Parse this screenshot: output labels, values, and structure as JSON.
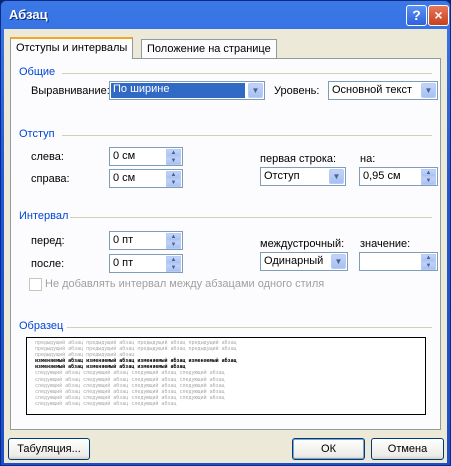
{
  "window": {
    "title": "Абзац",
    "help_glyph": "?",
    "close_glyph": "×"
  },
  "tabs": [
    {
      "label": "Отступы и интервалы",
      "active": true
    },
    {
      "label": "Положение на странице",
      "active": false
    }
  ],
  "general": {
    "heading": "Общие",
    "alignment_label": "Выравнивание:",
    "alignment_value": "По ширине",
    "level_label": "Уровень:",
    "level_value": "Основной текст"
  },
  "indent": {
    "heading": "Отступ",
    "left_label": "слева:",
    "left_value": "0 см",
    "right_label": "справа:",
    "right_value": "0 см",
    "first_line_label": "первая строка:",
    "first_line_value": "Отступ",
    "by_label": "на:",
    "by_value": "0,95 см"
  },
  "spacing": {
    "heading": "Интервал",
    "before_label": "перед:",
    "before_value": "0 пт",
    "after_label": "после:",
    "after_value": "0 пт",
    "line_label": "междустрочный:",
    "line_value": "Одинарный",
    "at_label": "значение:",
    "at_value": "",
    "dont_add_label": "Не добавлять интервал между абзацами одного стиля",
    "dont_add_checked": false
  },
  "preview": {
    "heading": "Образец",
    "prev_lines": [
      "предыдущий абзац предыдущий абзац предыдущий абзац предыдущий абзац",
      "предыдущий абзац предыдущий абзац предыдущий абзац предыдущий абзац",
      "предыдущий абзац предыдущий абзац"
    ],
    "cur_lines": [
      "    изменяемый абзац изменяемый абзац изменяемый абзац изменяемый абзац",
      "изменяемый абзац изменяемый абзац изменяемый абзац"
    ],
    "next_lines": [
      "следующий абзац следующий абзац следующий абзац следующий абзац",
      "следующий абзац следующий абзац следующий абзац следующий абзац",
      "следующий абзац следующий абзац следующий абзац следующий абзац",
      "следующий абзац следующий абзац следующий абзац следующий абзац",
      "следующий абзац следующий абзац следующий абзац следующий абзац",
      "следующий абзац следующий абзац следующий абзац"
    ]
  },
  "buttons": {
    "tabs": "Табуляция...",
    "ok": "ОК",
    "cancel": "Отмена"
  },
  "icons": {
    "dropdown": "chevron-down-icon",
    "spin_up": "spin-up-icon",
    "spin_down": "spin-down-icon"
  }
}
